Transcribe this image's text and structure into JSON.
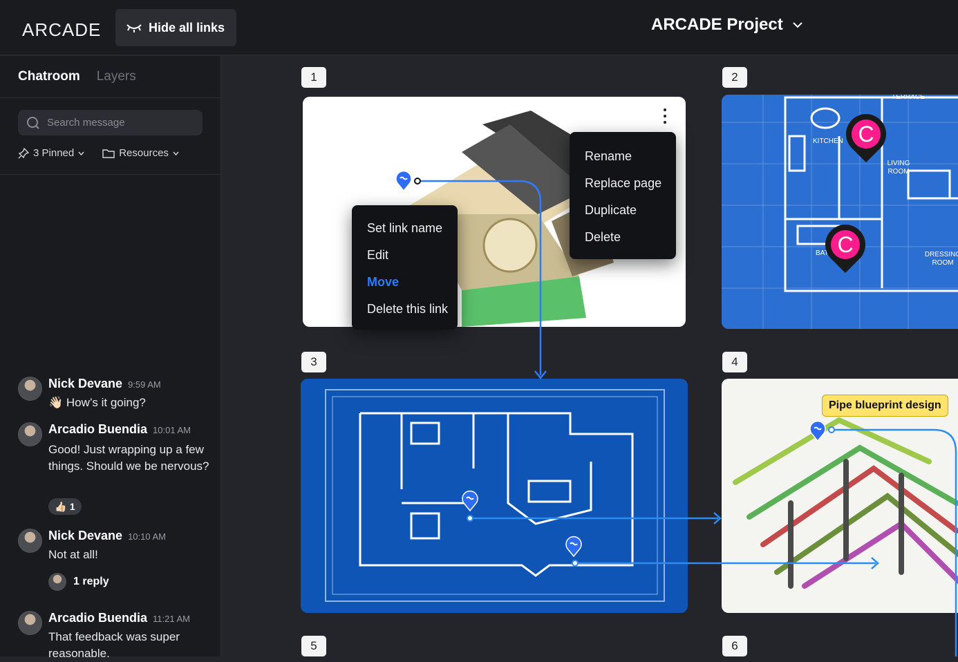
{
  "app": {
    "logo": "ARCADE",
    "hide_links": "Hide all links",
    "project_title": "ARCADE Project"
  },
  "sidebar": {
    "tabs": [
      "Chatroom",
      "Layers"
    ],
    "search_placeholder": "Search message",
    "pinned": "3 Pinned",
    "resources": "Resources"
  },
  "messages": [
    {
      "name": "Nick Devane",
      "time": "9:59 AM",
      "text": "👋🏻 How’s it going?"
    },
    {
      "name": "Arcadio Buendia",
      "time": "10:01 AM",
      "text": "Good! Just wrapping up a few things. Should we be nervous?",
      "reaction": "👍🏻",
      "reaction_count": "1"
    },
    {
      "name": "Nick Devane",
      "time": "10:10 AM",
      "text": "Not at all!",
      "reply": "1 reply"
    },
    {
      "name": "Arcadio Buendia",
      "time": "11:21 AM",
      "text": "That feedback was super reasonable."
    }
  ],
  "pages": [
    "1",
    "2",
    "3",
    "4",
    "5",
    "6"
  ],
  "link_menu": [
    "Set link name",
    "Edit",
    "Move",
    "Delete this link"
  ],
  "page_menu": [
    "Rename",
    "Replace page",
    "Duplicate",
    "Delete"
  ],
  "link_label": "Pipe blueprint design",
  "badge_letter": "C",
  "blueprint_labels": {
    "terrace": "TERRACE",
    "kitchen": "KITCHEN",
    "living": "LIVING ROOM",
    "dressing": "DRESSING ROOM",
    "bath": "BAT"
  },
  "colors": {
    "accent": "#2f7bff",
    "link": "#2d8cf0",
    "badge": "#ff1c8d",
    "blueprint": "#1f5fbf",
    "label": "#ffe36a"
  }
}
